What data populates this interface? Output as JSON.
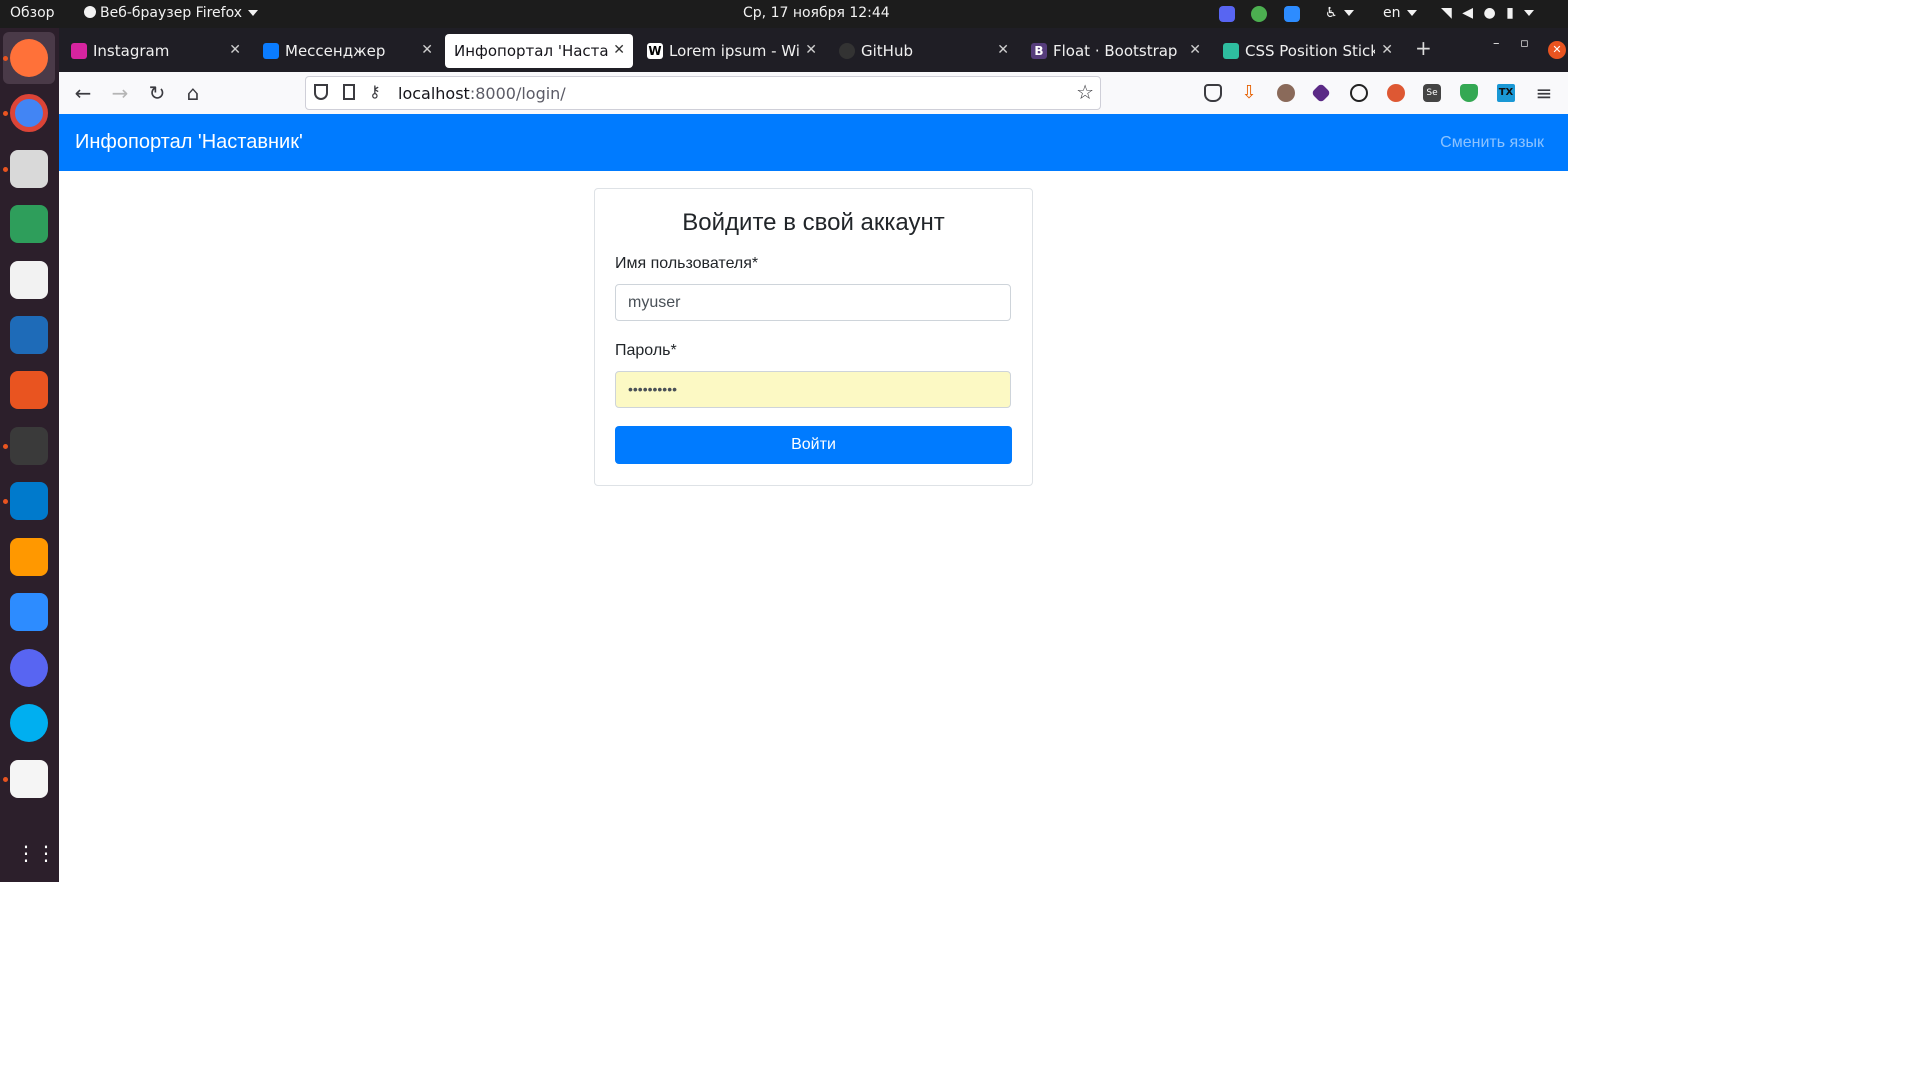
{
  "system_bar": {
    "overview": "Обзор",
    "app_menu": "Веб-браузер Firefox",
    "datetime": "Ср, 17 ноября  12:44",
    "keyboard_layout": "en"
  },
  "browser": {
    "tabs": [
      {
        "label": "Instagram",
        "icon": "instagram-icon",
        "color": "#d6249f"
      },
      {
        "label": "Мессенджер",
        "icon": "messenger-icon",
        "color": "#0a7cff"
      },
      {
        "label": "Инфопортал 'Наставник'",
        "icon": "none",
        "color": "#ffffff"
      },
      {
        "label": "Lorem ipsum - Wikipedia",
        "icon": "wikipedia-icon",
        "color": "#ffffff"
      },
      {
        "label": "GitHub",
        "icon": "github-icon",
        "color": "#333333"
      },
      {
        "label": "Float · Bootstrap",
        "icon": "bootstrap-icon",
        "color": "#563d7c"
      },
      {
        "label": "CSS Position Sticky",
        "icon": "css-icon",
        "color": "#2ebd9f"
      }
    ],
    "url_host": "localhost",
    "url_rest": ":8000/login/"
  },
  "page": {
    "brand": "Инфопортал 'Наставник'",
    "change_language": "Сменить язык",
    "form": {
      "title": "Войдите в свой аккаунт",
      "username_label": "Имя пользователя*",
      "username_value": "myuser",
      "password_label": "Пароль*",
      "password_value": "••••••••••",
      "submit_label": "Войти"
    }
  },
  "colors": {
    "primary": "#007bff",
    "autofill": "#fcf9c4"
  }
}
